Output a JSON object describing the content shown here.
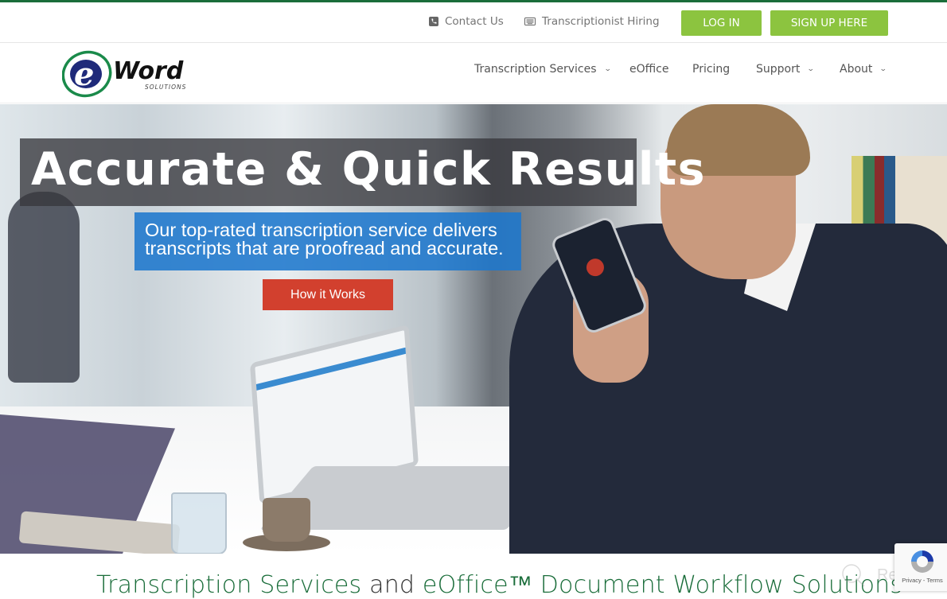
{
  "colors": {
    "brand_green": "#1a6d3a",
    "button_green": "#8cc43f",
    "hero_blue": "#1e78cd",
    "cta_red": "#d2402e"
  },
  "utility_bar": {
    "contact": {
      "label": "Contact Us",
      "icon": "phone-icon"
    },
    "hiring": {
      "label": "Transcriptionist Hiring",
      "icon": "keyboard-icon"
    },
    "login_label": "LOG IN",
    "signup_label": "SIGN UP HERE"
  },
  "logo": {
    "letter": "e",
    "word": "Word",
    "tagline": "SOLUTIONS"
  },
  "nav": {
    "items": [
      {
        "label": "Transcription Services",
        "dropdown": true
      },
      {
        "label": "eOffice",
        "dropdown": false
      },
      {
        "label": "Pricing",
        "dropdown": false
      },
      {
        "label": "Support",
        "dropdown": true
      },
      {
        "label": "About",
        "dropdown": true
      }
    ],
    "chevron": "⌄"
  },
  "hero": {
    "headline": "Accurate & Quick Results",
    "subline_1": "Our top-rated transcription service delivers",
    "subline_2": "transcripts that are proofread and accurate.",
    "cta_label": "How it Works"
  },
  "tagline": {
    "part1": "Transcription Services",
    "part2": " and ",
    "part3": "eOffice™ Document Workflow Solutions"
  },
  "recaptcha": {
    "text": "Privacy - Terms"
  },
  "watermark": {
    "text": "Revain"
  }
}
